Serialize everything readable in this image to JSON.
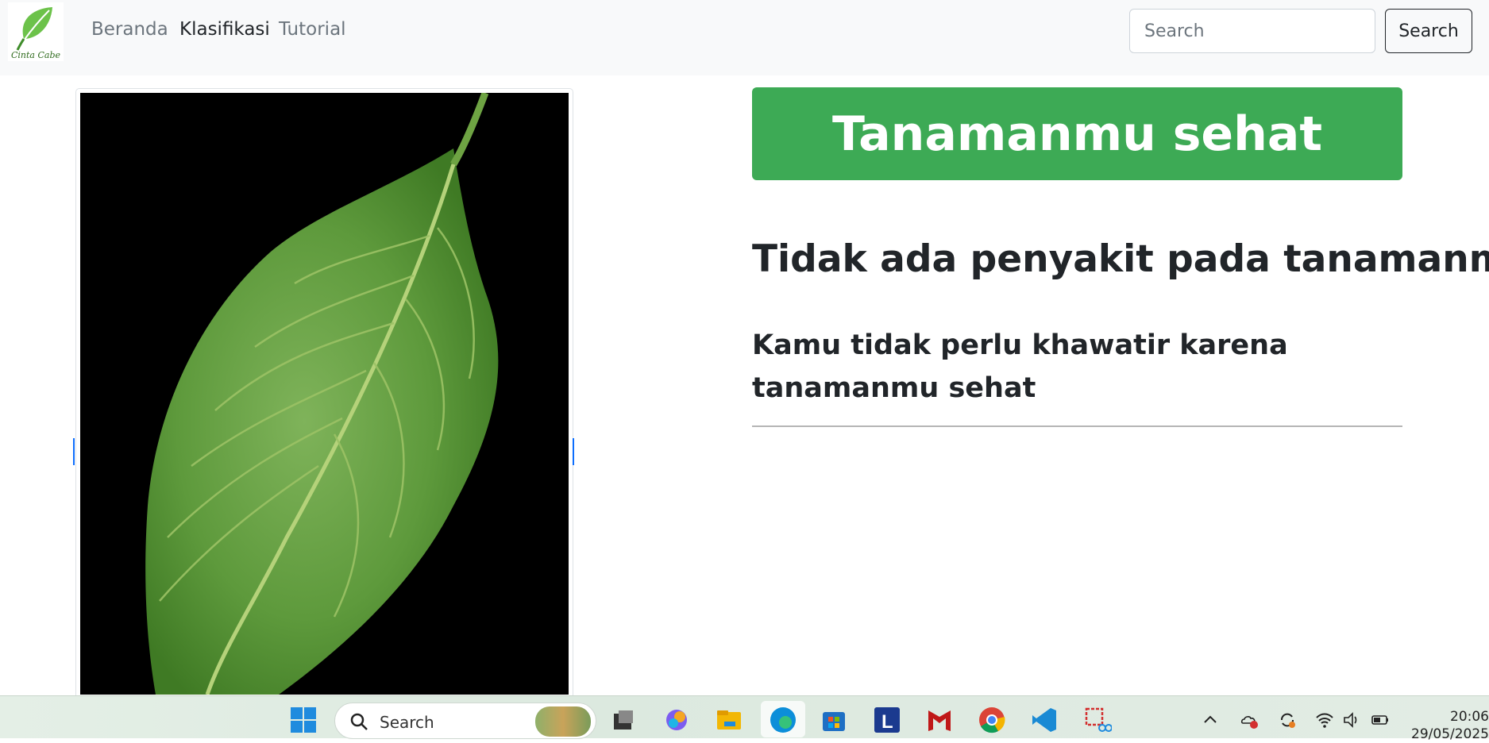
{
  "brand": {
    "logo_text": "Cinta Cabe"
  },
  "nav": {
    "items": [
      {
        "label": "Beranda",
        "active": false
      },
      {
        "label": "Klasifikasi",
        "active": true
      },
      {
        "label": "Tutorial",
        "active": false
      }
    ]
  },
  "search": {
    "placeholder": "Search",
    "button_label": "Search"
  },
  "result": {
    "status": "Tanamanmu sehat",
    "title": "Tidak ada penyakit pada tanamanmu",
    "description": "Kamu tidak perlu khawatir karena tanamanmu sehat"
  },
  "taskbar": {
    "search_placeholder": "Search",
    "time": "20:06",
    "date": "29/05/2025"
  },
  "colors": {
    "accent_green": "#3daa55",
    "navbar_bg": "#f8f9fa",
    "text_dark": "#212529",
    "text_muted": "#6c757d"
  }
}
